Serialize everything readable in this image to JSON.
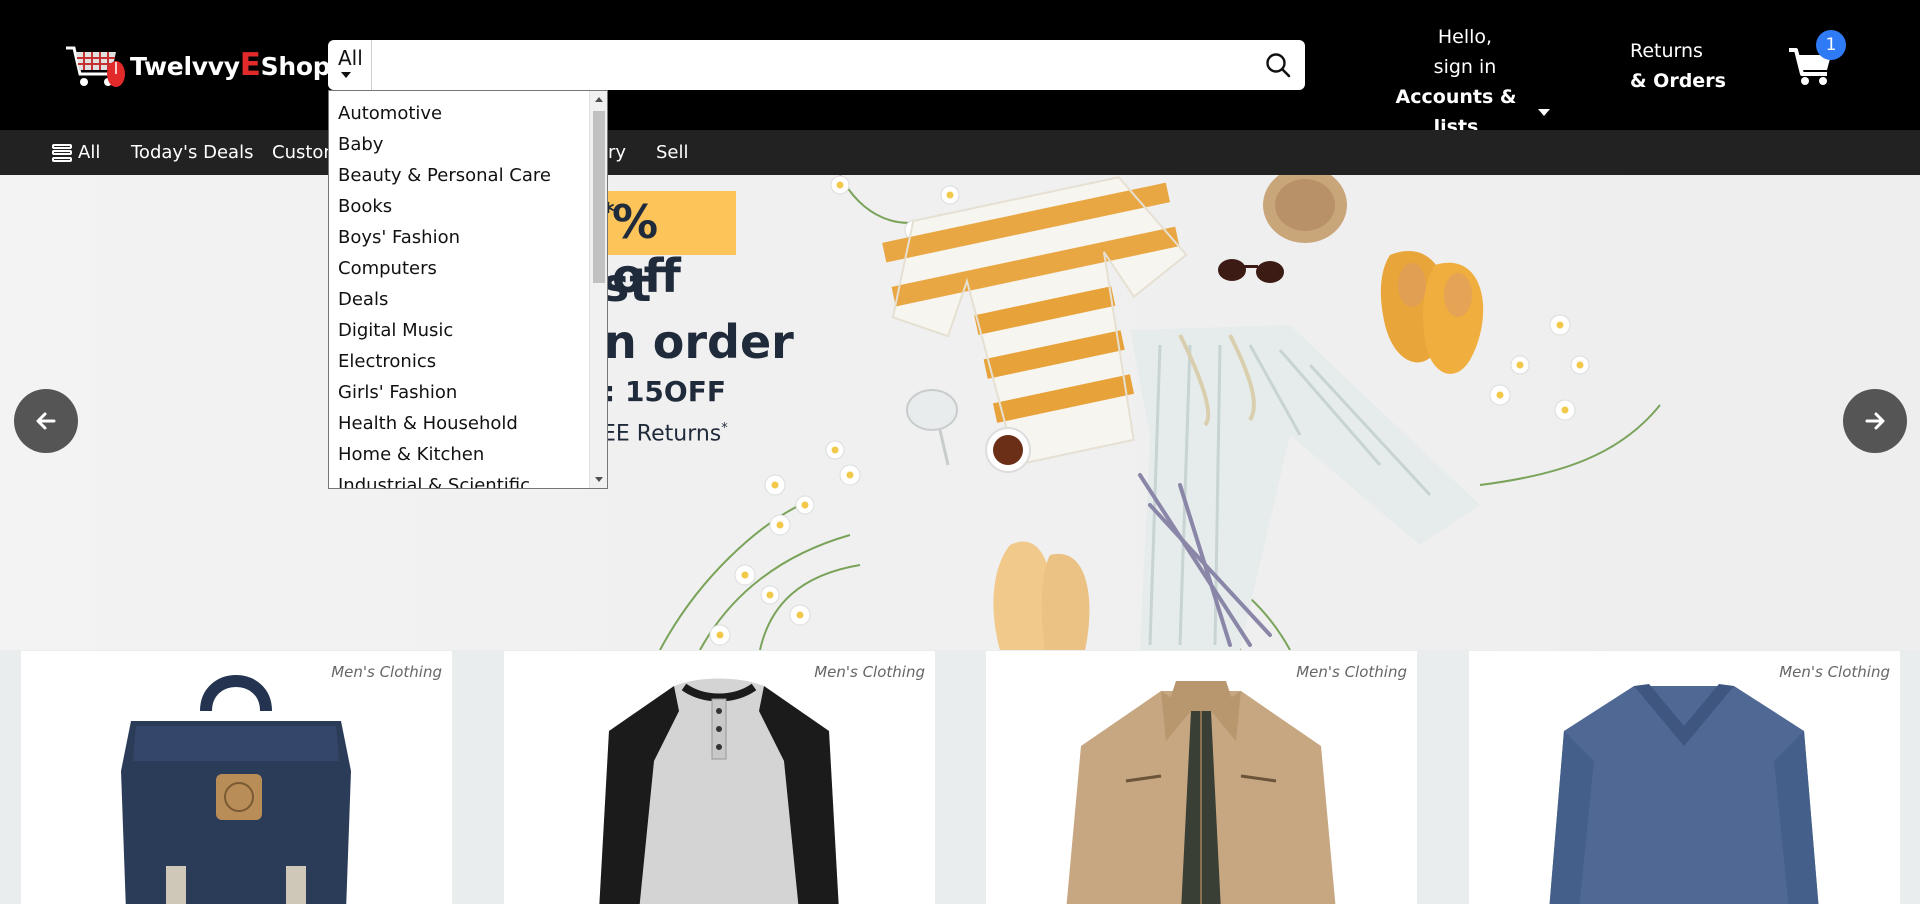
{
  "header": {
    "logo": {
      "part1": "Twelvvy",
      "part2": "E",
      "part3": "Shop."
    },
    "search": {
      "category_label": "All",
      "placeholder": "",
      "value": ""
    },
    "account": {
      "greeting": "Hello,",
      "signin": "sign in",
      "menu_label": "Accounts & lists"
    },
    "returns": {
      "line1": "Returns",
      "line2": "& Orders"
    },
    "cart": {
      "count": "1"
    }
  },
  "navbar": {
    "all_label": "All",
    "items": [
      "Today's Deals",
      "Custon",
      "ry",
      "Sell"
    ]
  },
  "hero": {
    "badge": "% off",
    "badge_sup": "*",
    "line1": "st",
    "line2": "n order",
    "line3": ": 15OFF",
    "line4": "EE Returns",
    "line4_sup": "*"
  },
  "dropdown": {
    "options": [
      "Automotive",
      "Baby",
      "Beauty & Personal Care",
      "Books",
      "Boys' Fashion",
      "Computers",
      "Deals",
      "Digital Music",
      "Electronics",
      "Girls' Fashion",
      "Health & Household",
      "Home & Kitchen",
      "Industrial & Scientific"
    ]
  },
  "products": [
    {
      "category": "Men's Clothing",
      "image": "backpack-image"
    },
    {
      "category": "Men's Clothing",
      "image": "raglan-henley-shirt-image"
    },
    {
      "category": "Men's Clothing",
      "image": "khaki-jacket-image"
    },
    {
      "category": "Men's Clothing",
      "image": "blue-vneck-shirt-image"
    }
  ],
  "colors": {
    "header_bg": "#000000",
    "navbar_bg": "#222222",
    "badge_yellow": "#fdc45a",
    "cart_badge": "#2f7bf5",
    "logo_accent": "#e32a2a"
  }
}
